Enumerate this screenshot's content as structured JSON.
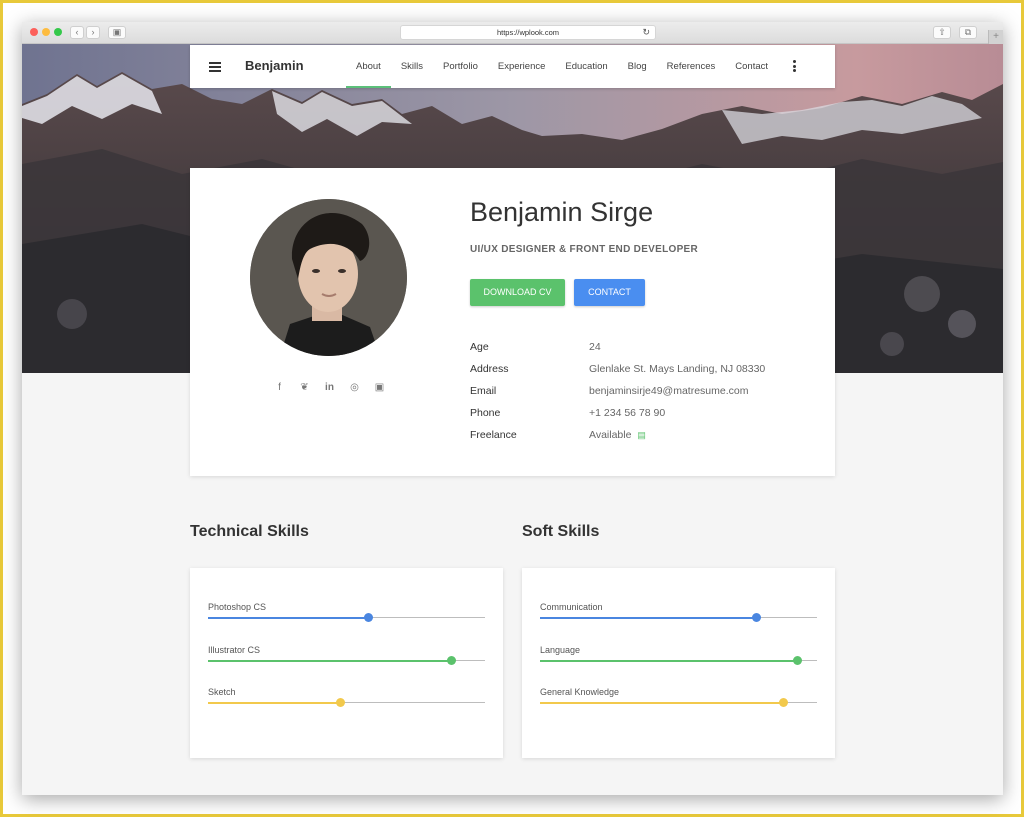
{
  "browser": {
    "url": "https://wplook.com"
  },
  "nav": {
    "brand": "Benjamin",
    "items": [
      {
        "label": "About",
        "active": true
      },
      {
        "label": "Skills"
      },
      {
        "label": "Portfolio"
      },
      {
        "label": "Experience"
      },
      {
        "label": "Education"
      },
      {
        "label": "Blog"
      },
      {
        "label": "References"
      },
      {
        "label": "Contact"
      }
    ]
  },
  "profile": {
    "name": "Benjamin Sirge",
    "role": "UI/UX DESIGNER & FRONT END DEVELOPER",
    "buttons": {
      "download": "DOWNLOAD CV",
      "contact": "CONTACT"
    },
    "social": [
      "facebook-icon",
      "twitter-icon",
      "linkedin-icon",
      "dribbble-icon",
      "instagram-icon"
    ],
    "info": [
      {
        "label": "Age",
        "value": "24"
      },
      {
        "label": "Address",
        "value": "Glenlake St. Mays Landing, NJ 08330"
      },
      {
        "label": "Email",
        "value": "benjaminsirje49@matresume.com"
      },
      {
        "label": "Phone",
        "value": "+1 234 56 78 90"
      },
      {
        "label": "Freelance",
        "value": "Available"
      }
    ]
  },
  "technical_skills": {
    "title": "Technical Skills",
    "items": [
      {
        "label": "Photoshop CS",
        "level": 0.58,
        "color": "#4a86e0"
      },
      {
        "label": "Illustrator CS",
        "level": 0.88,
        "color": "#5bc26c"
      },
      {
        "label": "Sketch",
        "level": 0.48,
        "color": "#f2c94c"
      }
    ]
  },
  "soft_skills": {
    "title": "Soft Skills",
    "items": [
      {
        "label": "Communication",
        "level": 0.78,
        "color": "#4a86e0"
      },
      {
        "label": "Language",
        "level": 0.93,
        "color": "#5bc26c"
      },
      {
        "label": "General Knowledge",
        "level": 0.88,
        "color": "#f2c94c"
      }
    ]
  },
  "colors": {
    "accent_green": "#5bc26c",
    "accent_blue": "#4a8ef0",
    "frame": "#e8c93a"
  }
}
